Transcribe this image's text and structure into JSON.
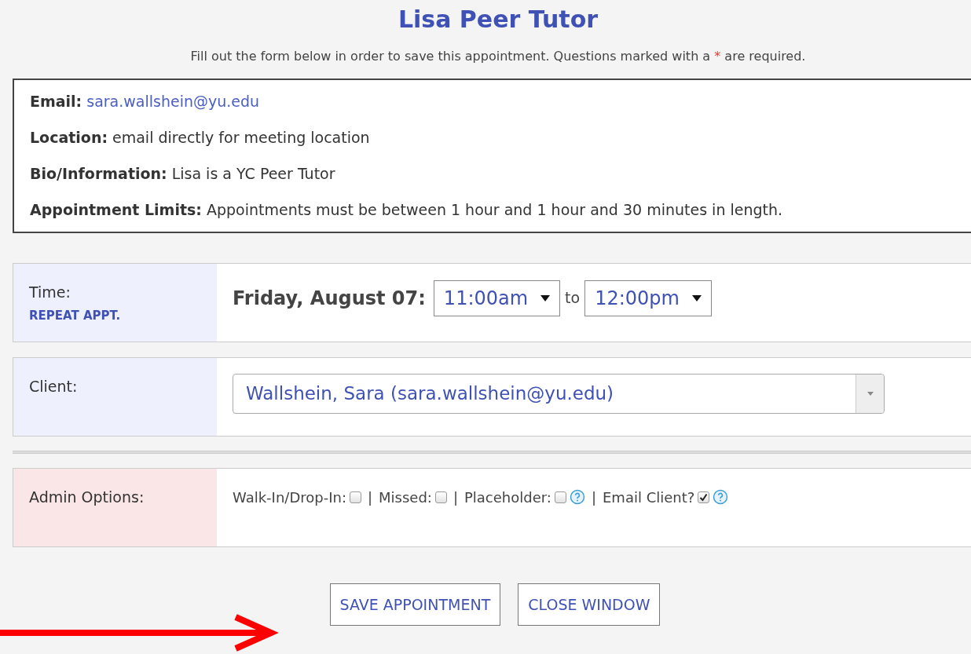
{
  "title": "Lisa Peer Tutor",
  "instructions": {
    "before": "Fill out the form below in order to save this appointment. Questions marked with a",
    "required_mark": "*",
    "after": "are required."
  },
  "info": [
    {
      "label": "Email:",
      "value": "sara.wallshein@yu.edu",
      "kind": "link"
    },
    {
      "label": "Location:",
      "value": "email directly for meeting location",
      "kind": "text"
    },
    {
      "label": "Bio/Information:",
      "value": "Lisa is a YC Peer Tutor",
      "kind": "text"
    },
    {
      "label": "Appointment Limits:",
      "value": "Appointments must be between 1 hour and 1 hour and 30 minutes in length.",
      "kind": "text"
    }
  ],
  "time": {
    "label": "Time:",
    "repeat_link": "REPEAT APPT.",
    "date": "Friday, August 07:",
    "start": "11:00am",
    "to": "to",
    "end": "12:00pm"
  },
  "client": {
    "label": "Client:",
    "value": "Wallshein, Sara (sara.wallshein@yu.edu)"
  },
  "admin": {
    "label": "Admin Options:",
    "options": [
      {
        "label": "Walk-In/Drop-In:",
        "checked": false,
        "help": false
      },
      {
        "separator": "|",
        "label": "Missed:",
        "checked": false,
        "help": false
      },
      {
        "separator": "|",
        "label": "Placeholder:",
        "checked": false,
        "help": true
      },
      {
        "separator": "|",
        "label": "Email Client?",
        "checked": true,
        "help": true
      }
    ]
  },
  "buttons": [
    "SAVE APPOINTMENT",
    "CLOSE WINDOW"
  ]
}
